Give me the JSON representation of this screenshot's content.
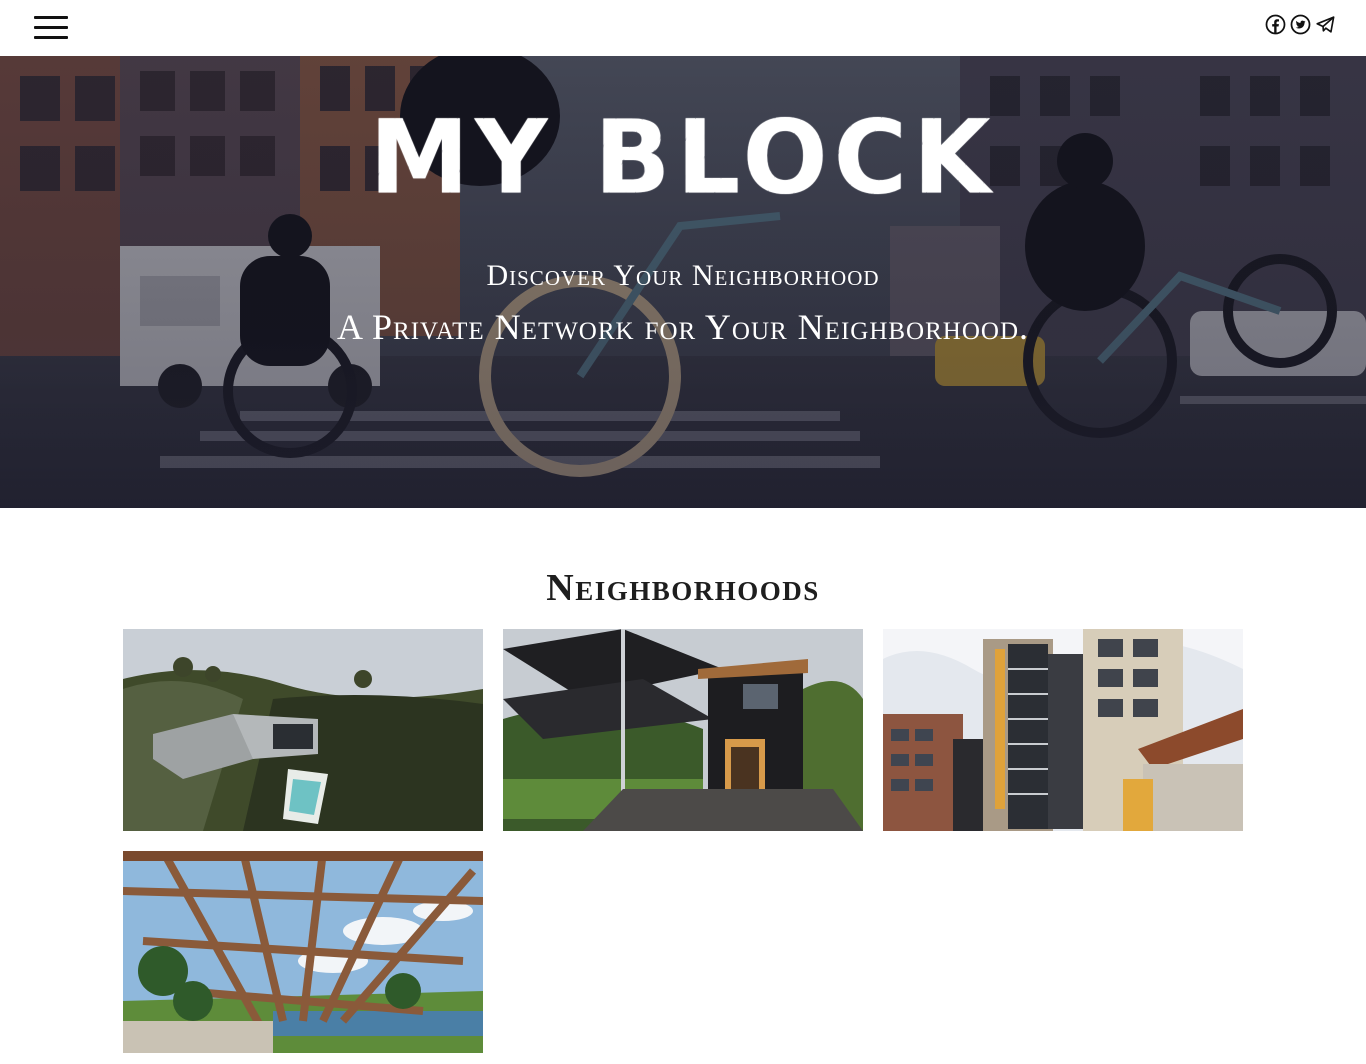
{
  "header": {
    "menu_icon": "hamburger-menu-icon",
    "socials": [
      {
        "icon": "facebook-icon"
      },
      {
        "icon": "twitter-icon"
      },
      {
        "icon": "telegram-icon"
      }
    ]
  },
  "hero": {
    "title": "MY BLOCK",
    "tagline": "Discover Your Neighborhood",
    "subtitle": "A Private Network for Your Neighborhood."
  },
  "neighborhoods": {
    "heading": "Neighborhoods",
    "cards": [
      {
        "image": "hillside-modern-house-photo"
      },
      {
        "image": "black-tiny-cabin-photo"
      },
      {
        "image": "apartment-building-photo"
      },
      {
        "image": "glass-pergola-pool-photo"
      }
    ]
  }
}
